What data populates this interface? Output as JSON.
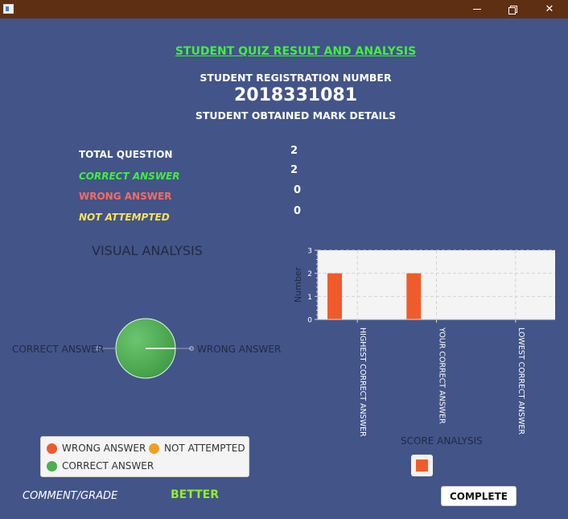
{
  "window": {
    "minimize_icon": "minimize-icon",
    "restore_icon": "restore-icon",
    "close_symbol": "✕"
  },
  "header": {
    "title": "STUDENT QUIZ RESULT AND ANALYSIS",
    "registration_label": "STUDENT REGISTRATION NUMBER",
    "registration_number": "2018331081",
    "marks_label": "STUDENT OBTAINED MARK DETAILS"
  },
  "stats": [
    {
      "label": "TOTAL QUESTION",
      "value": "2",
      "color": "#ffffff"
    },
    {
      "label": "CORRECT ANSWER",
      "value": "2",
      "color": "#3ff03f"
    },
    {
      "label": "WRONG ANSWER",
      "value": "0",
      "color": "#ff6a5c"
    },
    {
      "label": "NOT ATTEMPTED",
      "value": "0",
      "color": "#f7e35a"
    }
  ],
  "visual": {
    "title": "VISUAL ANALYSIS",
    "pie_left_label": "CORRECT ANSWER",
    "pie_right_label": "WRONG ANSWER",
    "legend": [
      {
        "label": "WRONG ANSWER",
        "color": "#ee5a2a"
      },
      {
        "label": "NOT ATTEMPTED",
        "color": "#f0a020"
      },
      {
        "label": "CORRECT ANSWER",
        "color": "#4caf50"
      }
    ]
  },
  "chart_data": {
    "type": "bar",
    "categories": [
      "HIGHEST CORRECT ANSWER",
      "YOUR CORRECT ANSWER",
      "LOWEST CORRECT ANSWER"
    ],
    "values": [
      2,
      2,
      0
    ],
    "ylabel": "Number",
    "ylim": [
      0,
      3
    ],
    "yticks": [
      0,
      1,
      2,
      3
    ],
    "title": "SCORE ANALYSIS",
    "bar_color": "#f05b2b",
    "grid": true
  },
  "footer": {
    "comment_label": "COMMENT/GRADE",
    "grade": "BETTER",
    "complete_label": "COMPLETE"
  }
}
